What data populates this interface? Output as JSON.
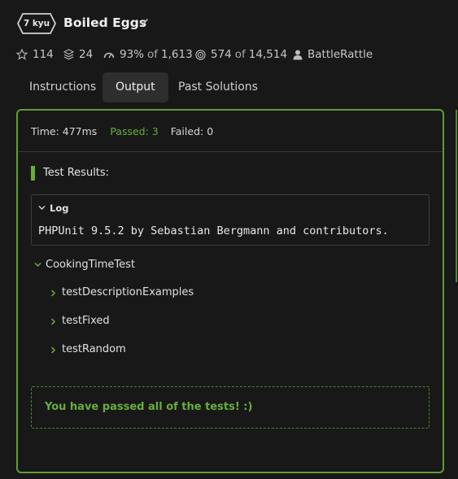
{
  "kata": {
    "rank": "7 kyu",
    "title": "Boiled Eggs"
  },
  "stats": {
    "stars": "114",
    "collections": "24",
    "satisfaction": "93%",
    "satisfaction_of": "of",
    "satisfaction_total": "1,613",
    "completed": "574",
    "completed_of": "of",
    "completed_total": "14,514",
    "author": "BattleRattle"
  },
  "tabs": [
    "Instructions",
    "Output",
    "Past Solutions"
  ],
  "active_tab": "Output",
  "summary": {
    "time": "Time: 477ms",
    "passed": "Passed: 3",
    "failed": "Failed: 0"
  },
  "results": {
    "title": "Test Results:",
    "log_label": "Log",
    "log_line": "PHPUnit 9.5.2 by Sebastian Bergmann and contributors.",
    "suite": "CookingTimeTest",
    "tests": [
      "testDescriptionExamples",
      "testFixed",
      "testRandom"
    ],
    "success_message": "You have passed all of the tests! :)"
  },
  "colors": {
    "accent_green": "#67ad3d",
    "panel_border": "#5d9d34",
    "background": "#181818"
  }
}
